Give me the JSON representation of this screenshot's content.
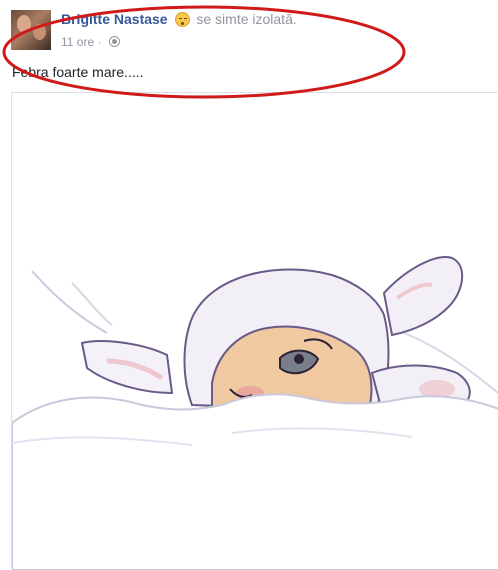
{
  "post": {
    "author": "Brigitte Nastase",
    "feeling": "se simte izolată.",
    "feeling_icon": "sleepy-emoji-icon",
    "time": "11 ore",
    "separator": "·",
    "privacy_icon": "globe-icon",
    "text": "Febra foarte mare....."
  },
  "colors": {
    "author_link": "#365899",
    "meta_gray": "#90949c",
    "annotation_red": "#d01a1a"
  },
  "image": {
    "icon": "sick-bunny-illustration"
  }
}
